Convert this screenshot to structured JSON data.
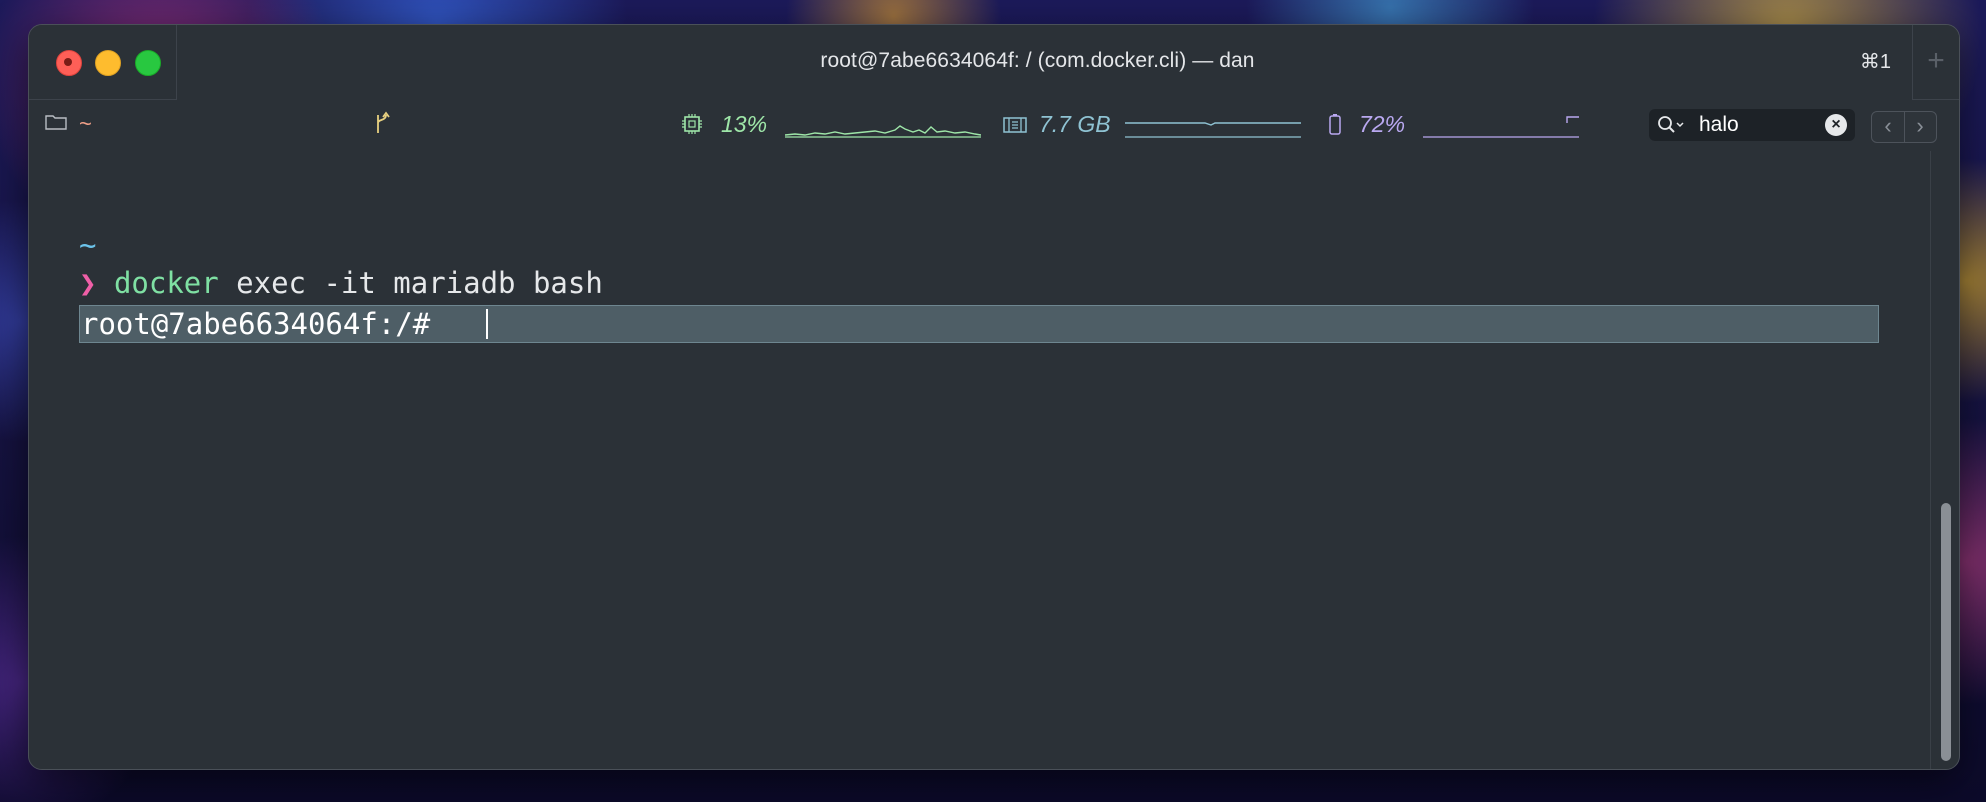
{
  "window": {
    "title": "root@7abe6634064f: / (com.docker.cli) — dan",
    "shortcut": "⌘1",
    "new_tab_label": "+"
  },
  "statusbar": {
    "directory": "~",
    "cpu": {
      "value": "13%",
      "color": "#9ee6a8"
    },
    "memory": {
      "value": "7.7 GB",
      "color": "#8fc3d3"
    },
    "battery": {
      "value": "72%",
      "color": "#b9a8f0",
      "level": 0.72
    }
  },
  "search": {
    "value": "halo",
    "clear_label": "×",
    "prev_label": "‹",
    "next_label": "›"
  },
  "terminal": {
    "cwd_line": "~",
    "prompt_symbol": "❯",
    "command_name": "docker",
    "command_args": " exec -it mariadb bash",
    "container_prompt": "root@7abe6634064f:/# "
  },
  "colors": {
    "background": "#2b3137",
    "prompt_arrow": "#ef5fa7",
    "command_name": "#7fe0a3",
    "cwd": "#6cc3ea",
    "highlight": "#4e5e66"
  }
}
